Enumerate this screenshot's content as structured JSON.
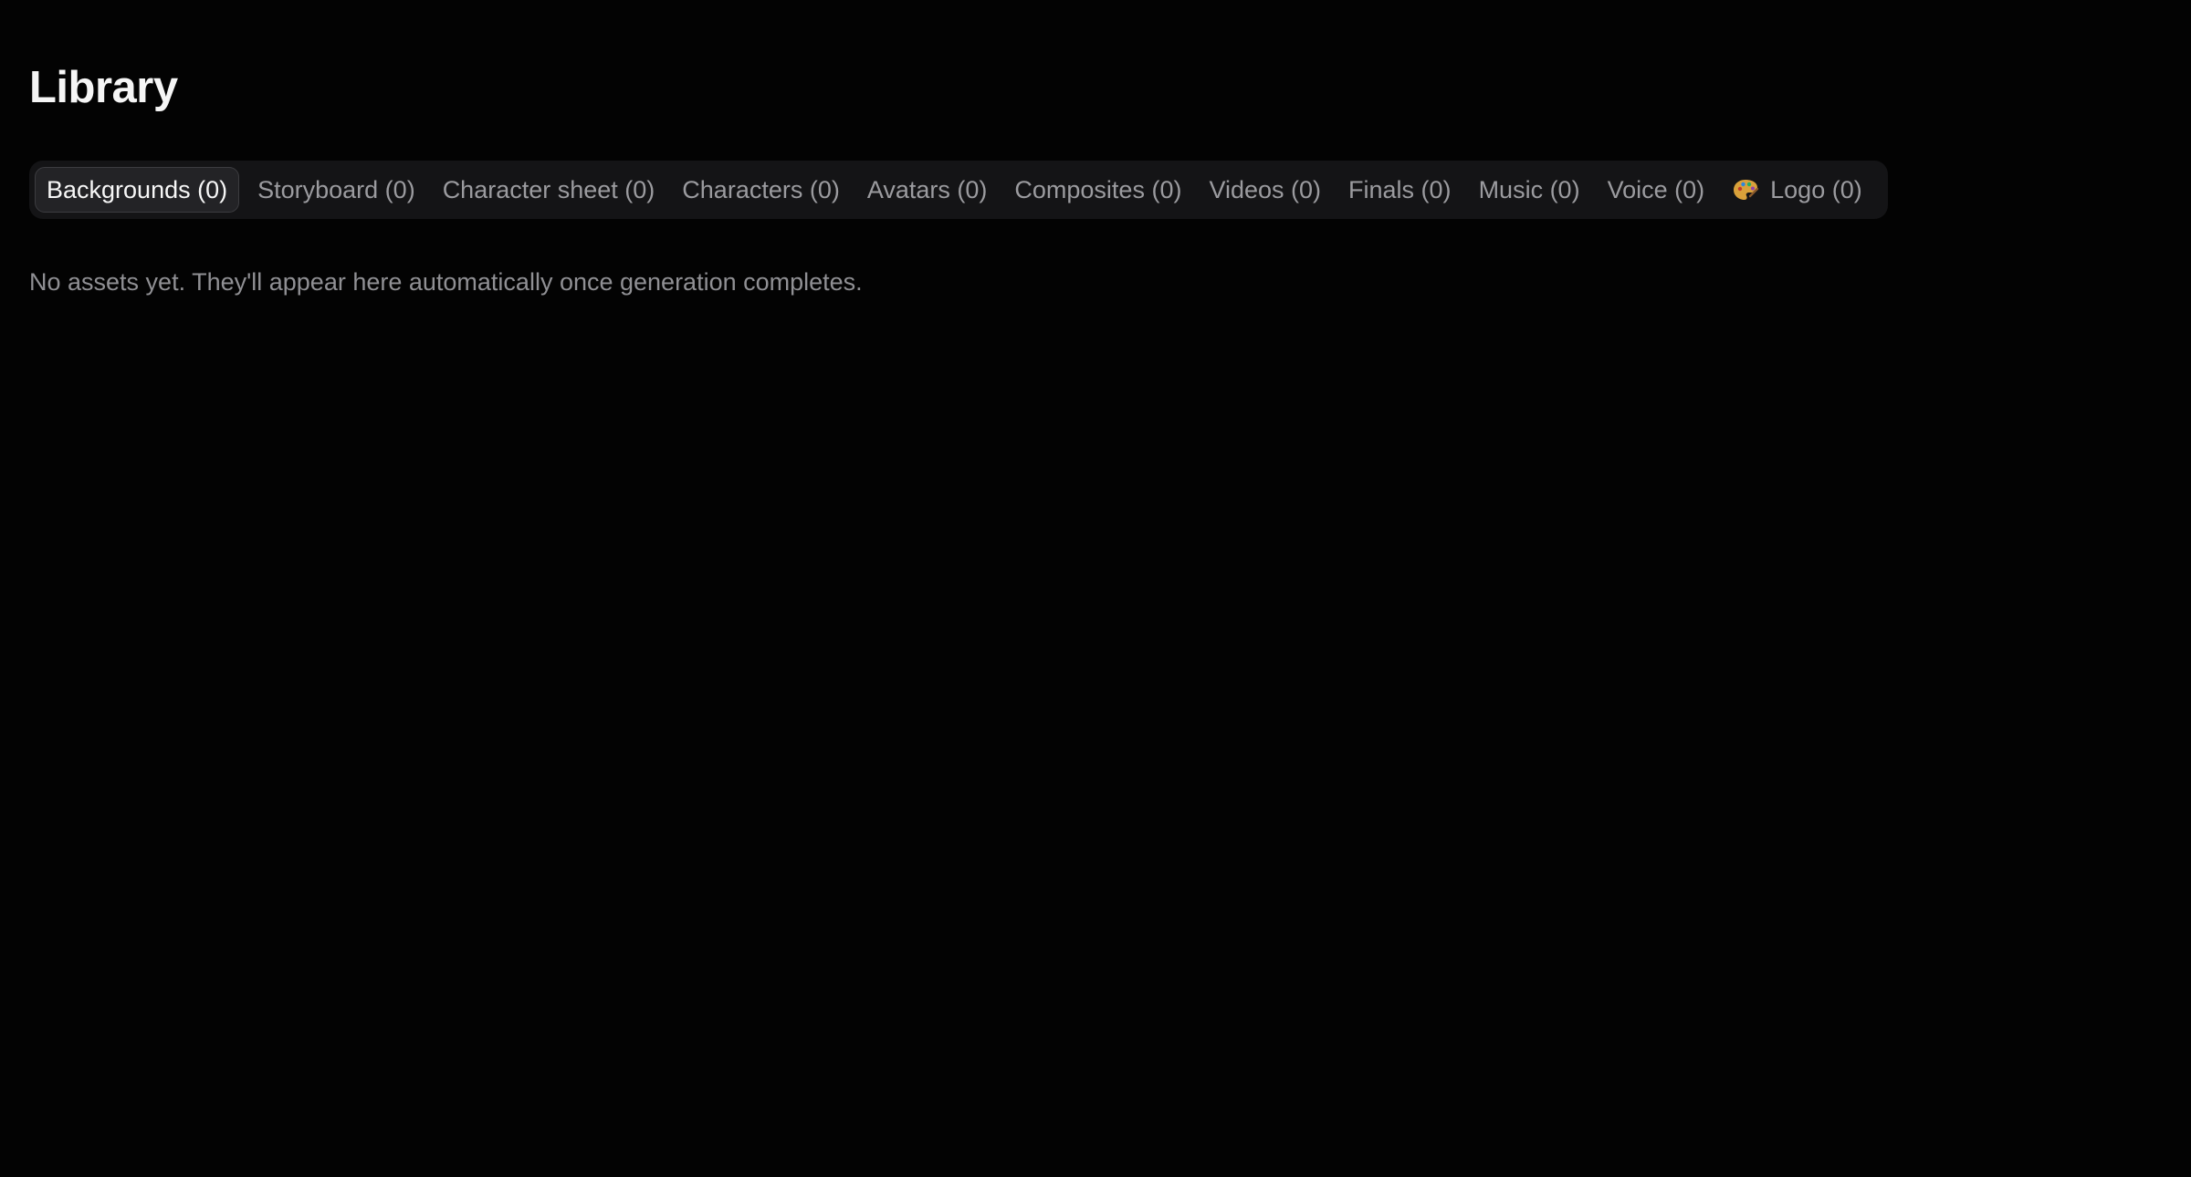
{
  "page": {
    "title": "Library"
  },
  "tabs": [
    {
      "label": "Backgrounds (0)",
      "active": true
    },
    {
      "label": "Storyboard (0)"
    },
    {
      "label": "Character sheet (0)"
    },
    {
      "label": "Characters (0)"
    },
    {
      "label": "Avatars (0)"
    },
    {
      "label": "Composites (0)"
    },
    {
      "label": "Videos (0)"
    },
    {
      "label": "Finals (0)"
    },
    {
      "label": "Music (0)"
    },
    {
      "label": "Voice (0)"
    },
    {
      "label": "Logo (0)",
      "icon": "palette-icon"
    }
  ],
  "empty_state": {
    "message": "No assets yet. They'll appear here automatically once generation completes."
  },
  "colors": {
    "background": "#030303",
    "tab_bar": "#141416",
    "tab_active": "#232326",
    "text_muted": "#9b9b9f",
    "palette_icon": "#d9a13a"
  }
}
